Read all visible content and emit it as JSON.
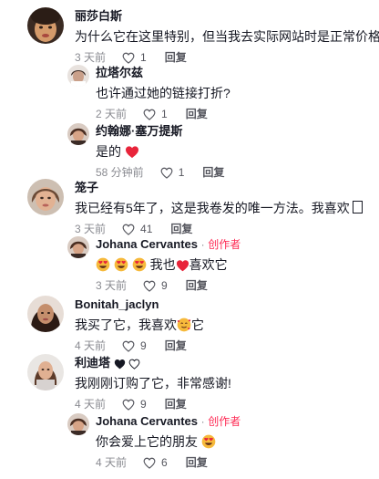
{
  "comments": [
    {
      "name": "丽莎白斯",
      "text": "为什么它在这里特别，但当我去实际网站时是正常价格?",
      "time": "3 天前",
      "likes": "1",
      "reply": "回复"
    },
    {
      "name": "拉塔尔兹",
      "text": "也许通过她的链接打折?",
      "time": "2 天前",
      "likes": "1",
      "reply": "回复"
    },
    {
      "name": "约翰娜·塞万提斯",
      "text": "是的",
      "time": "58 分钟前",
      "likes": "1",
      "reply": "回复"
    },
    {
      "name": "笼子",
      "text": "我已经有5年了，这是我卷发的唯一方法。我喜欢",
      "time": "3 天前",
      "likes": "41",
      "reply": "回复"
    },
    {
      "name": "Johana Cervantes",
      "dot": "·",
      "badge": "创作者",
      "text_a": "我也",
      "text_b": "喜欢它",
      "time": "3 天前",
      "likes": "9",
      "reply": "回复"
    },
    {
      "name": "Bonitah_jaclyn",
      "text_a": "我买了它，我喜欢",
      "text_b": "它",
      "time": "4 天前",
      "likes": "9",
      "reply": "回复"
    },
    {
      "name": "利迪塔",
      "text": "我刚刚订购了它，非常感谢!",
      "time": "4 天前",
      "likes": "9",
      "reply": "回复"
    },
    {
      "name": "Johana Cervantes",
      "dot": "·",
      "badge": "创作者",
      "text": "你会爱上它的朋友",
      "time": "4 天前",
      "likes": "6",
      "reply": "回复"
    }
  ],
  "colors": {
    "creator": "#fe2c55",
    "meta": "#8a8b91",
    "text": "#161823"
  },
  "icons": [
    "heart-outline-icon",
    "red-heart-emoji",
    "heart-eyes-emoji",
    "smiling-hearts-emoji",
    "black-heart-emoji",
    "white-heart-emoji"
  ]
}
